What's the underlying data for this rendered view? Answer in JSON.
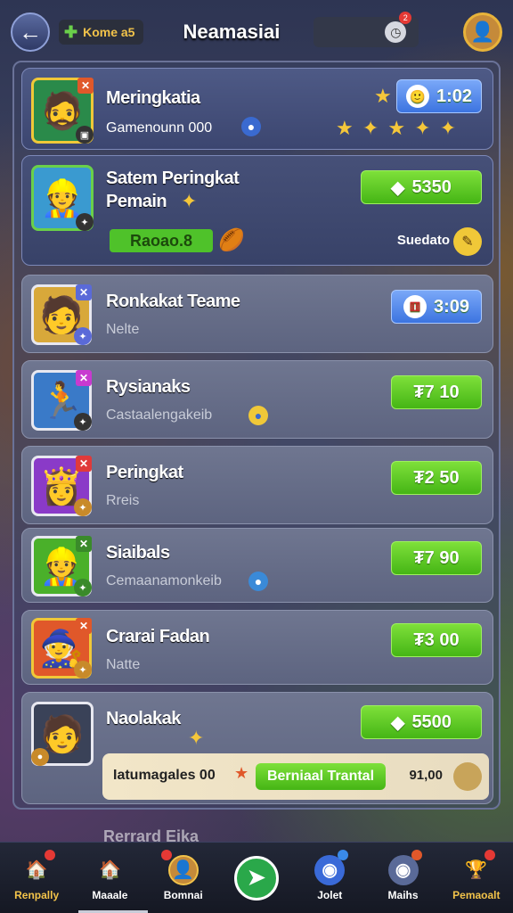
{
  "header": {
    "title": "Neamasiai",
    "chip_label": "Kome a5",
    "notif_count": "2",
    "back_label": "←",
    "chip_icon": "✚",
    "profile_icon": "👤"
  },
  "featured": [
    {
      "name": "Meringkatia",
      "sub": "Gamenounn 000",
      "sub_icon": "●",
      "button": "1:02",
      "button_style": "blue",
      "badge_x": "✕",
      "badge_b": "▣",
      "art": "🧔",
      "stars": "★ ✦ ★ ✦ ✦",
      "star_top": "★",
      "btn_icon": "🙂"
    },
    {
      "name": "Satem Peringkat",
      "name2": "Pemain",
      "tag": "Raoao.8",
      "button": "5350",
      "button_style": "green",
      "side_label": "Suedato",
      "art": "👷",
      "btn_icon": "◆",
      "side_icon": "✎",
      "tag_icon": "🏉",
      "badge_b": "✦",
      "name_icon": "✦"
    }
  ],
  "list": [
    {
      "name": "Ronkakat Teame",
      "sub": "Nelte",
      "button": "3:09",
      "button_style": "blue",
      "art": "🧑",
      "badge": "✕",
      "btn_icon": "⚅",
      "badge_b": "✦"
    },
    {
      "name": "Rysianaks",
      "sub": "Castaalengakeib",
      "sub_icon": "●",
      "button": "₮7 10",
      "button_style": "green",
      "art": "🏃",
      "badge": "✕",
      "badge_b": "✦"
    },
    {
      "name": "Peringkat",
      "sub": "Rreis",
      "button": "₮2 50",
      "button_style": "green",
      "art": "👸",
      "badge": "✕",
      "badge_b": "✦"
    },
    {
      "name": "Siaibals",
      "sub": "Cemaanamonkeib",
      "sub_icon": "●",
      "button": "₮7 90",
      "button_style": "green",
      "art": "👷",
      "badge": "✕",
      "badge_b": "✦"
    },
    {
      "name": "Crarai Fadan",
      "sub": "Natte",
      "button": "₮3 00",
      "button_style": "green",
      "art": "🧙",
      "badge": "✕",
      "badge_b": "✦"
    },
    {
      "name": "Naolakak",
      "button": "5500",
      "button_style": "green",
      "art": "🧑",
      "btn_icon": "◆",
      "name_icon": "✦",
      "badge_b": "●"
    }
  ],
  "banner": {
    "left": "Iatumagales 00",
    "button": "Berniaal Trantal",
    "right": "91,00",
    "left_icon": "★"
  },
  "peek": {
    "name": "Rerrard Eika"
  },
  "tabs": [
    {
      "label": "Renpally",
      "icon": "🏠",
      "color": "#f2c34a",
      "badge": true
    },
    {
      "label": "Maaale",
      "icon": "🏠",
      "color": "#fff",
      "badge": false
    },
    {
      "label": "Bomnai",
      "icon": "👤",
      "color": "#fff",
      "badge": true
    },
    {
      "label": "",
      "icon": "➤",
      "color": "#fff",
      "badge": false
    },
    {
      "label": "Jolet",
      "icon": "◉",
      "color": "#fff",
      "badge": true
    },
    {
      "label": "Maihs",
      "icon": "◉",
      "color": "#fff",
      "badge": true
    },
    {
      "label": "Pemaoalt",
      "icon": "🏆",
      "color": "#f2c34a",
      "badge": true
    }
  ],
  "colors": {
    "accent_green": "#5ccc25",
    "accent_blue": "#4a86ec",
    "gold": "#f0c838"
  }
}
